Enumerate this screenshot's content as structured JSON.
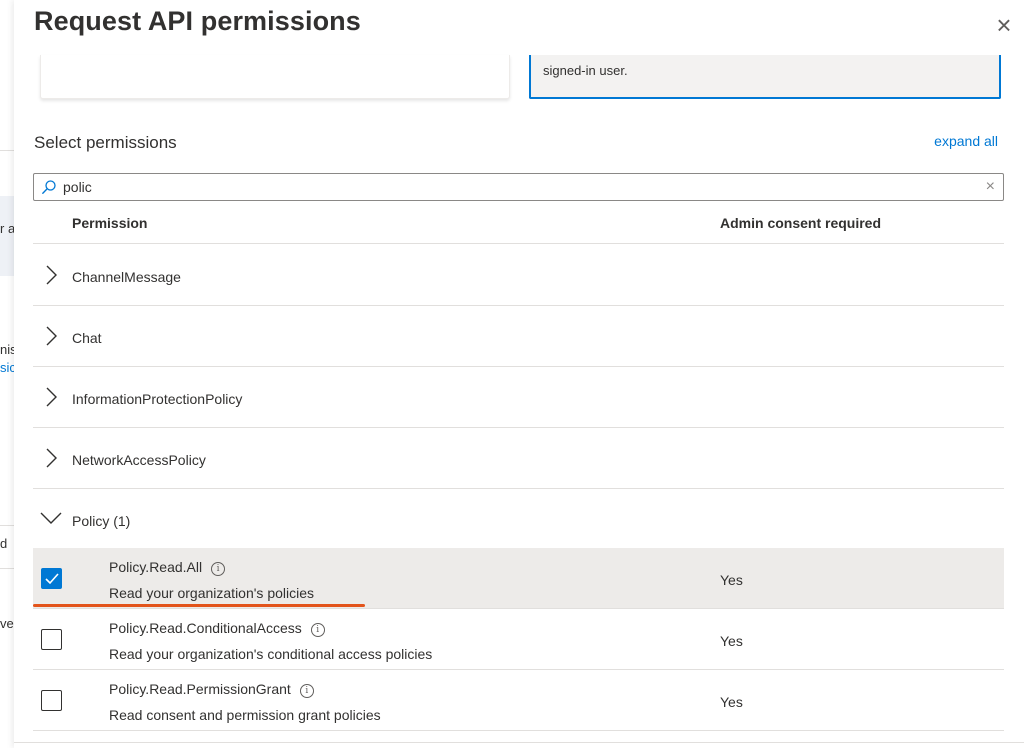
{
  "background": {
    "fragments": [
      {
        "text": "r a",
        "blue": false
      },
      {
        "text": "nis",
        "blue": false
      },
      {
        "text": "sic",
        "blue": true
      },
      {
        "text": "d",
        "blue": false
      },
      {
        "text": "ve",
        "blue": false
      }
    ]
  },
  "panel": {
    "title": "Request API permissions",
    "close_icon": "close-icon",
    "top_cards": {
      "right_text": "signed-in user."
    }
  },
  "permissions": {
    "section_title": "Select permissions",
    "expand_all": "expand all",
    "search": {
      "value": "polic",
      "placeholder": "",
      "icon": "search-icon",
      "clear_icon": "clear-icon"
    },
    "columns": {
      "permission": "Permission",
      "admin_consent": "Admin consent required"
    },
    "groups": [
      {
        "label": "ChannelMessage",
        "expanded": false
      },
      {
        "label": "Chat",
        "expanded": false
      },
      {
        "label": "InformationProtectionPolicy",
        "expanded": false
      },
      {
        "label": "NetworkAccessPolicy",
        "expanded": false
      },
      {
        "label": "Policy (1)",
        "expanded": true
      }
    ],
    "items": [
      {
        "name": "Policy.Read.All",
        "description": "Read your organization's policies",
        "admin_consent": "Yes",
        "checked": true
      },
      {
        "name": "Policy.Read.ConditionalAccess",
        "description": "Read your organization's conditional access policies",
        "admin_consent": "Yes",
        "checked": false
      },
      {
        "name": "Policy.Read.PermissionGrant",
        "description": "Read consent and permission grant policies",
        "admin_consent": "Yes",
        "checked": false
      }
    ]
  },
  "colors": {
    "accent": "#0078d4",
    "annotation_underline": "#e3541b",
    "selected_row": "#edebe9"
  }
}
